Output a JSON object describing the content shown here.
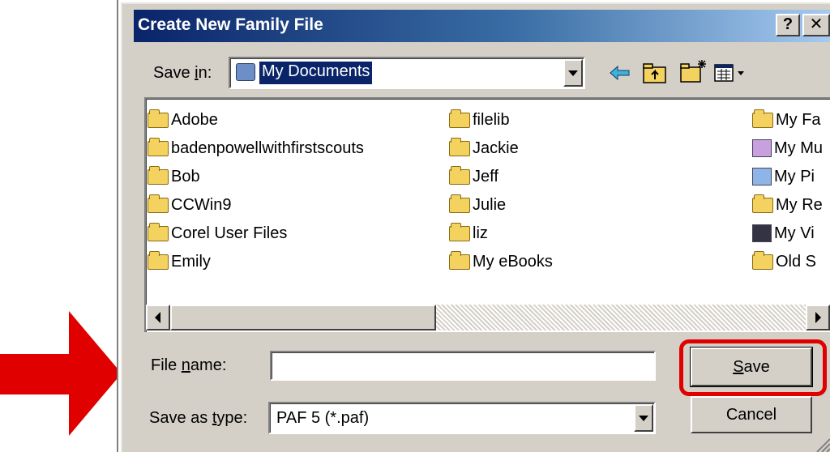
{
  "dialog": {
    "title": "Create New Family File",
    "help_btn": "?",
    "close_btn": "✕"
  },
  "save_in": {
    "label_pre": "Save ",
    "label_ul": "i",
    "label_post": "n:",
    "value": "My Documents"
  },
  "files": {
    "col1": [
      "Adobe",
      "badenpowellwithfirstscouts",
      "Bob",
      "CCWin9",
      "Corel User Files",
      "Emily"
    ],
    "col2": [
      "filelib",
      "Jackie",
      "Jeff",
      "Julie",
      "liz",
      "My eBooks"
    ],
    "col3": [
      "My Fa",
      "My Mu",
      "My Pi",
      "My Re",
      "My Vi",
      "Old S"
    ]
  },
  "file_name": {
    "label_pre": "File ",
    "label_ul": "n",
    "label_post": "ame:",
    "value": ""
  },
  "save_as_type": {
    "label_pre": "Save as ",
    "label_ul": "t",
    "label_post": "ype:",
    "value": "PAF 5 (*.paf)"
  },
  "buttons": {
    "save_ul": "S",
    "save_rest": "ave",
    "cancel": "Cancel"
  },
  "colors": {
    "highlight_red": "#e00000",
    "selection_blue": "#0a246a"
  }
}
